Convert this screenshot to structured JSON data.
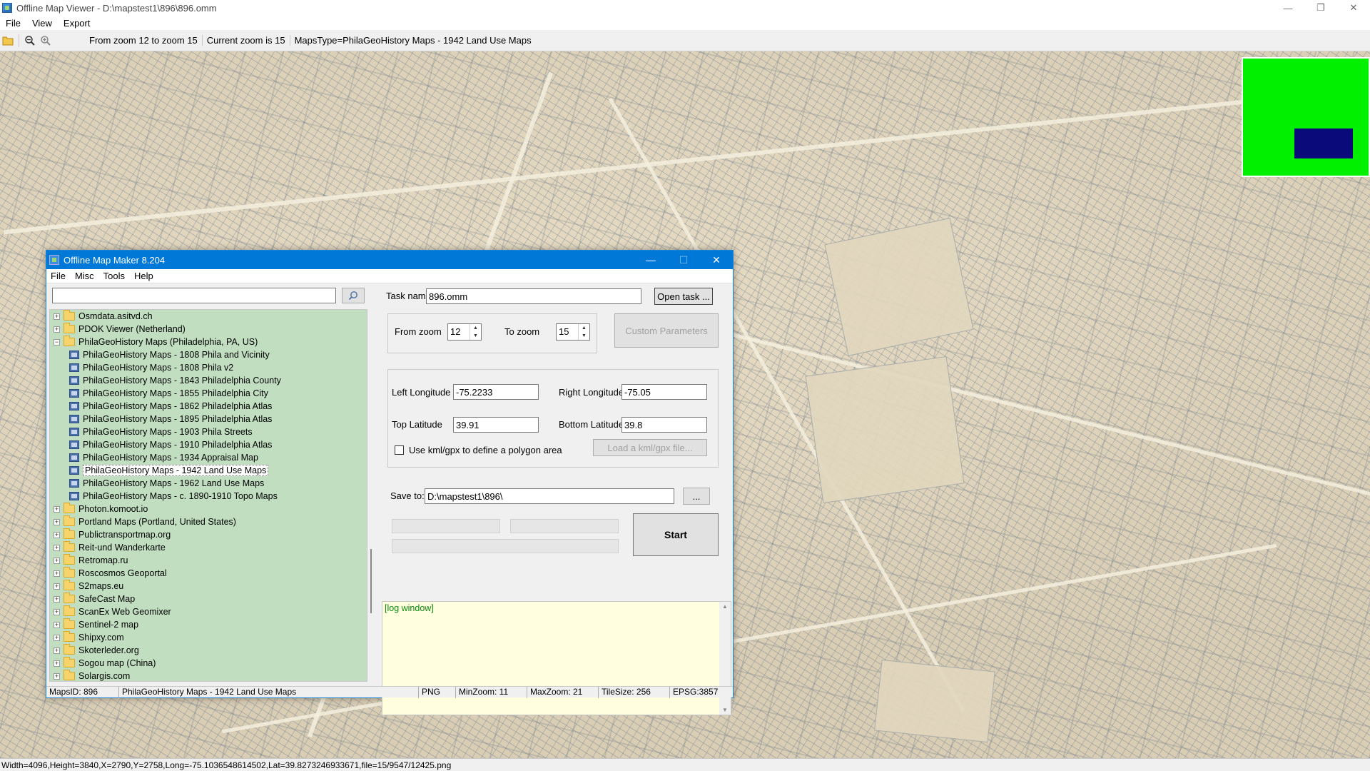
{
  "window": {
    "title": "Offline Map Viewer - D:\\mapstest1\\896\\896.omm",
    "controls": [
      "—",
      "❐",
      "✕"
    ]
  },
  "menu": [
    "File",
    "View",
    "Export"
  ],
  "toolbar": {
    "zoom_range": "From zoom 12 to zoom 15",
    "current_zoom": "Current zoom is 15",
    "maps_type": "MapsType=PhilaGeoHistory Maps - 1942 Land Use Maps"
  },
  "status": "Width=4096,Height=3840,X=2790,Y=2758,Long=-75.1036548614502,Lat=39.8273246933671,file=15/9547/12425.png",
  "dialog": {
    "title": "Offline Map Maker 8.204",
    "menu": [
      "File",
      "Misc",
      "Tools",
      "Help"
    ],
    "search_placeholder": "",
    "tree": [
      {
        "type": "folder",
        "label": "Osmdata.asitvd.ch",
        "expander": "+"
      },
      {
        "type": "folder",
        "label": "PDOK Viewer (Netherland)",
        "expander": "+"
      },
      {
        "type": "folder",
        "label": "PhilaGeoHistory Maps (Philadelphia, PA, US)",
        "expander": "−"
      },
      {
        "type": "leaf",
        "label": "PhilaGeoHistory Maps - 1808 Phila and Vicinity"
      },
      {
        "type": "leaf",
        "label": "PhilaGeoHistory Maps - 1808 Phila v2"
      },
      {
        "type": "leaf",
        "label": "PhilaGeoHistory Maps - 1843 Philadelphia County"
      },
      {
        "type": "leaf",
        "label": "PhilaGeoHistory Maps - 1855 Philadelphia City"
      },
      {
        "type": "leaf",
        "label": "PhilaGeoHistory Maps - 1862 Philadelphia Atlas"
      },
      {
        "type": "leaf",
        "label": "PhilaGeoHistory Maps - 1895 Philadelphia Atlas"
      },
      {
        "type": "leaf",
        "label": "PhilaGeoHistory Maps - 1903 Phila Streets"
      },
      {
        "type": "leaf",
        "label": "PhilaGeoHistory Maps - 1910 Philadelphia Atlas"
      },
      {
        "type": "leaf",
        "label": "PhilaGeoHistory Maps - 1934 Appraisal Map"
      },
      {
        "type": "leaf",
        "label": "PhilaGeoHistory Maps - 1942 Land Use Maps",
        "selected": true
      },
      {
        "type": "leaf",
        "label": "PhilaGeoHistory Maps - 1962 Land Use Maps"
      },
      {
        "type": "leaf",
        "label": "PhilaGeoHistory Maps - c. 1890-1910 Topo Maps"
      },
      {
        "type": "folder",
        "label": "Photon.komoot.io",
        "expander": "+"
      },
      {
        "type": "folder",
        "label": "Portland Maps (Portland, United States)",
        "expander": "+"
      },
      {
        "type": "folder",
        "label": "Publictransportmap.org",
        "expander": "+"
      },
      {
        "type": "folder",
        "label": "Reit-und Wanderkarte",
        "expander": "+"
      },
      {
        "type": "folder",
        "label": "Retromap.ru",
        "expander": "+"
      },
      {
        "type": "folder",
        "label": "Roscosmos Geoportal",
        "expander": "+"
      },
      {
        "type": "folder",
        "label": "S2maps.eu",
        "expander": "+"
      },
      {
        "type": "folder",
        "label": "SafeCast Map",
        "expander": "+"
      },
      {
        "type": "folder",
        "label": "ScanEx Web Geomixer",
        "expander": "+"
      },
      {
        "type": "folder",
        "label": "Sentinel-2 map",
        "expander": "+"
      },
      {
        "type": "folder",
        "label": "Shipxy.com",
        "expander": "+"
      },
      {
        "type": "folder",
        "label": "Skoterleder.org",
        "expander": "+"
      },
      {
        "type": "folder",
        "label": "Sogou map (China)",
        "expander": "+"
      },
      {
        "type": "folder",
        "label": "Solargis.com",
        "expander": "+"
      }
    ],
    "task_name_label": "Task name",
    "task_name_value": "896.omm",
    "open_task_button": "Open task ...",
    "from_zoom_label": "From zoom",
    "from_zoom_value": "12",
    "to_zoom_label": "To zoom",
    "to_zoom_value": "15",
    "custom_params_button": "Custom Parameters",
    "left_long_label": "Left Longitude",
    "left_long_value": "-75.2233",
    "right_long_label": "Right Longitude",
    "right_long_value": "-75.05",
    "top_lat_label": "Top Latitude",
    "top_lat_value": "39.91",
    "bottom_lat_label": "Bottom Latitude",
    "bottom_lat_value": "39.8",
    "kml_checkbox_label": "Use kml/gpx to define a polygon area",
    "kml_load_button": "Load a kml/gpx file...",
    "save_to_label": "Save to:",
    "save_to_value": "D:\\mapstest1\\896\\",
    "browse_button": "...",
    "start_button": "Start",
    "log_text": "[log window]",
    "status": {
      "maps_id": "MapsID: 896",
      "maps_name": "PhilaGeoHistory Maps - 1942 Land Use Maps",
      "format": "PNG",
      "min_zoom": "MinZoom: 11",
      "max_zoom": "MaxZoom: 21",
      "tile_size": "TileSize: 256",
      "epsg": "EPSG:3857"
    }
  }
}
